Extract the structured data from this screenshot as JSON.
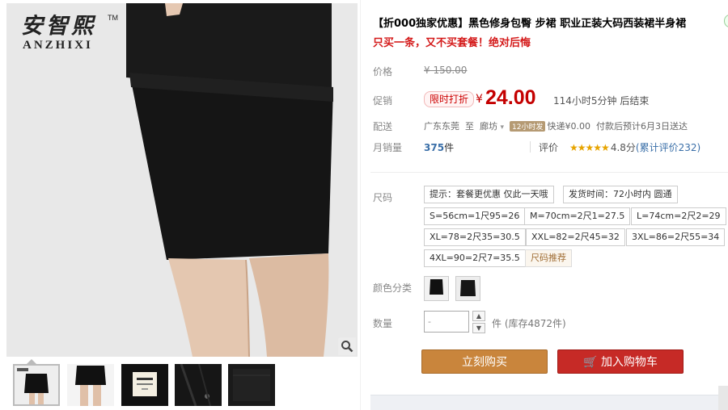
{
  "brand": {
    "name_cn": "安智熙",
    "name_en": "ANZHIXI",
    "trademark": "TM"
  },
  "product": {
    "title": "【折000独家优惠】黑色修身包臀  步裙 职业正装大码西装裙半身裙",
    "subtitle": "只买一条，又不买套餐！绝对后悔"
  },
  "price": {
    "label": "价格",
    "original": "¥ 150.00"
  },
  "promo": {
    "label": "促销",
    "tag": "限时打折",
    "currency": "¥",
    "value": "24.00",
    "countdown": "114小时5分钟 后结束"
  },
  "delivery": {
    "label": "配送",
    "from": "广东东莞",
    "to_word": "至",
    "to": "廊坊",
    "caret": "▾",
    "badge": "12小时发",
    "fee": "快递¥0.00",
    "eta": "付款后预计6月3日送达"
  },
  "sales": {
    "label": "月销量",
    "count": "375",
    "unit": "件",
    "rating_label": "评价",
    "stars": "★★★★★",
    "score": "4.8分",
    "reviews": "(累计评价232)"
  },
  "size": {
    "label": "尺码",
    "options": [
      "提示：套餐更优惠 仅此一天哦",
      "发货时间：72小时内 圆通",
      "S=56cm=1尺95=26",
      "M=70cm=2尺1=27.5",
      "L=74cm=2尺2=29",
      "XL=78=2尺35=30.5",
      "XXL=82=2尺45=32",
      "3XL=86=2尺55=34",
      "4XL=90=2尺7=35.5"
    ],
    "recommend": "尺码推荐"
  },
  "color": {
    "label": "颜色分类"
  },
  "quantity": {
    "label": "数量",
    "value": "-",
    "stock": "件 (库存4872件)",
    "up": "▲",
    "down": "▼"
  },
  "actions": {
    "buy": "立刻购买",
    "cart": "加入购物车",
    "cart_icon": "🛒"
  },
  "colors": {
    "accent_red": "#c40000",
    "buy_orange": "#c9853c",
    "cart_red": "#c62a26",
    "link_blue": "#3a6fa8"
  },
  "icons": {
    "zoom": "magnifier-icon",
    "cart": "cart-icon",
    "rank": "award-icon"
  }
}
